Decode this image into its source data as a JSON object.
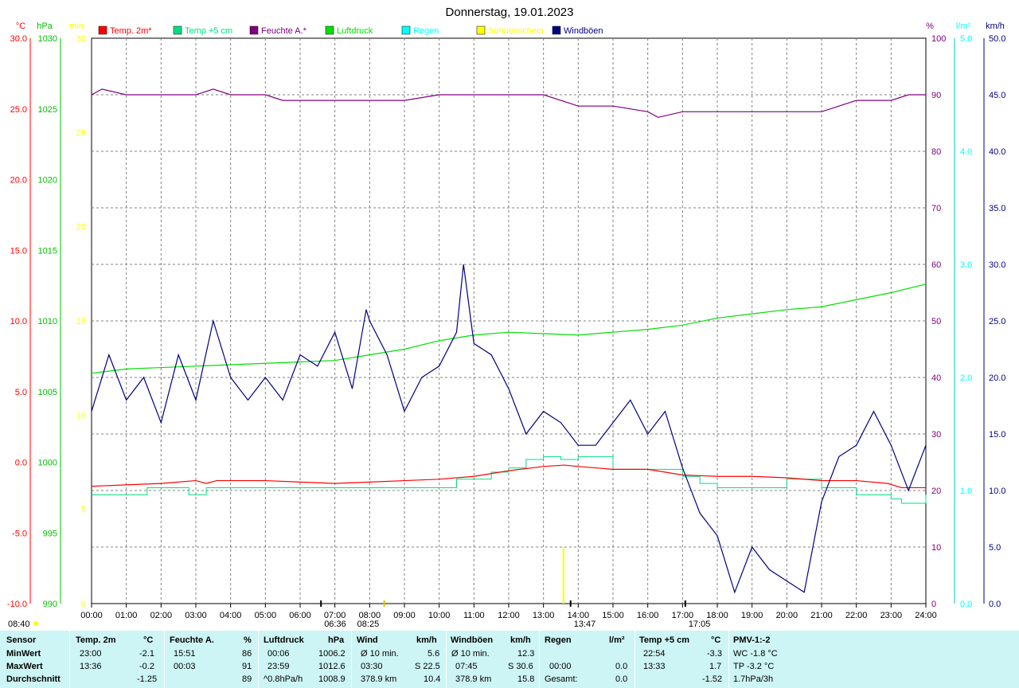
{
  "chart_data": {
    "type": "line",
    "title": "Donnerstag, 19.01.2023",
    "x_ticks": [
      "00:00",
      "01:00",
      "02:00",
      "03:00",
      "04:00",
      "05:00",
      "06:00",
      "07:00",
      "08:00",
      "09:00",
      "10:00",
      "11:00",
      "12:00",
      "13:00",
      "14:00",
      "15:00",
      "16:00",
      "17:00",
      "18:00",
      "19:00",
      "20:00",
      "21:00",
      "22:00",
      "23:00",
      "24:00"
    ],
    "axes": {
      "temp": {
        "unit": "°C",
        "color": "#ff0000",
        "range": [
          -10,
          30
        ],
        "ticks": [
          "30.0",
          "25.0",
          "20.0",
          "15.0",
          "10.0",
          "5.0",
          "0.0",
          "-5.0",
          "-10.0"
        ]
      },
      "press": {
        "unit": "hPa",
        "color": "#00c000",
        "range": [
          990,
          1030
        ],
        "ticks": [
          "1030",
          "1025",
          "1020",
          "1015",
          "1010",
          "1005",
          "1000",
          "995",
          "990"
        ]
      },
      "sun": {
        "unit": "min",
        "color": "#ffff00",
        "range": [
          0,
          30
        ],
        "ticks": [
          "30",
          "25",
          "20",
          "15",
          "10",
          "5",
          "0"
        ]
      },
      "hum": {
        "unit": "%",
        "color": "#800080",
        "range": [
          0,
          100
        ],
        "ticks": [
          "100",
          "90",
          "80",
          "70",
          "60",
          "50",
          "40",
          "30",
          "20",
          "10",
          "0"
        ]
      },
      "rain": {
        "unit": "l/m²",
        "color": "#00ffff",
        "range": [
          0,
          5
        ],
        "ticks": [
          "5.0",
          "4.0",
          "3.0",
          "2.0",
          "1.0",
          "0.0"
        ]
      },
      "wind": {
        "unit": "km/h",
        "color": "#000080",
        "range": [
          0,
          50
        ],
        "ticks": [
          "50.0",
          "45.0",
          "40.0",
          "35.0",
          "30.0",
          "25.0",
          "20.0",
          "15.0",
          "10.0",
          "5.0",
          "0.0"
        ]
      }
    },
    "legend": [
      {
        "name": "Temp. 2m*",
        "color": "#ff0000"
      },
      {
        "name": "Temp +5 cm",
        "color": "#00e080"
      },
      {
        "name": "Feuchte A.*",
        "color": "#800080"
      },
      {
        "name": "Luftdruck",
        "color": "#00e000"
      },
      {
        "name": "Regen",
        "color": "#00ffff"
      },
      {
        "name": "Sonnenschein",
        "color": "#ffff00"
      },
      {
        "name": "Windböen",
        "color": "#000080"
      }
    ],
    "series": {
      "temp2m": {
        "x": [
          0,
          1,
          2,
          3,
          3.3,
          3.6,
          4,
          5,
          6,
          7,
          8,
          9,
          10,
          11,
          12,
          13,
          13.6,
          14,
          15,
          16,
          17,
          18,
          19,
          20,
          21,
          22,
          22.9,
          23.3,
          24
        ],
        "y": [
          -1.7,
          -1.6,
          -1.5,
          -1.3,
          -1.5,
          -1.3,
          -1.3,
          -1.3,
          -1.4,
          -1.5,
          -1.4,
          -1.3,
          -1.2,
          -1.0,
          -0.6,
          -0.3,
          -0.2,
          -0.3,
          -0.5,
          -0.5,
          -0.9,
          -1.0,
          -1.0,
          -1.1,
          -1.3,
          -1.3,
          -1.5,
          -1.8,
          -1.8
        ]
      },
      "temp5cm": {
        "x": [
          0,
          1.5,
          1.6,
          2,
          2.8,
          3.3,
          4,
          5,
          6,
          7,
          8,
          9,
          10,
          10.5,
          11,
          11.5,
          12,
          12.5,
          13,
          13.5,
          14,
          15,
          16,
          17,
          17.5,
          18,
          19,
          20,
          21,
          21.5,
          22,
          23,
          23.3,
          24
        ],
        "y": [
          -2.3,
          -2.3,
          -1.8,
          -1.8,
          -2.3,
          -1.8,
          -1.8,
          -1.8,
          -1.8,
          -1.8,
          -1.8,
          -1.8,
          -1.8,
          -1.2,
          -1.2,
          -0.7,
          -0.4,
          0.2,
          0.4,
          0.2,
          0.4,
          -0.5,
          -0.5,
          -1.0,
          -1.5,
          -1.8,
          -1.8,
          -1.2,
          -1.8,
          -1.8,
          -2.3,
          -2.6,
          -2.9,
          -2.3
        ]
      },
      "humidity": {
        "x": [
          0,
          0.3,
          1,
          2,
          3,
          3.5,
          4,
          5,
          5.5,
          6,
          7,
          8,
          9,
          10,
          11,
          12,
          13,
          13.5,
          14,
          15,
          16,
          16.3,
          17,
          18,
          19,
          20,
          20.5,
          21,
          22,
          23,
          23.5,
          24
        ],
        "y": [
          90,
          91,
          90,
          90,
          90,
          91,
          90,
          90,
          89,
          89,
          89,
          89,
          89,
          90,
          90,
          90,
          90,
          89,
          88,
          88,
          87,
          86,
          87,
          87,
          87,
          87,
          87,
          87,
          89,
          89,
          90,
          90
        ]
      },
      "pressure": {
        "x": [
          0,
          1,
          2,
          3,
          4,
          5,
          6,
          7,
          8,
          9,
          10,
          11,
          12,
          13,
          14,
          15,
          16,
          17,
          18,
          19,
          20,
          21,
          22,
          23,
          24
        ],
        "y": [
          1006.3,
          1006.6,
          1006.7,
          1006.8,
          1006.9,
          1007.0,
          1007.1,
          1007.2,
          1007.6,
          1008.0,
          1008.6,
          1009.0,
          1009.2,
          1009.1,
          1009.0,
          1009.2,
          1009.4,
          1009.7,
          1010.2,
          1010.5,
          1010.8,
          1011.0,
          1011.5,
          1012.0,
          1012.6
        ]
      },
      "gusts": {
        "x": [
          0,
          0.5,
          1,
          1.5,
          2,
          2.5,
          3,
          3.5,
          4,
          4.5,
          5,
          5.5,
          6,
          6.5,
          7,
          7.5,
          7.9,
          8,
          8.5,
          9,
          9.5,
          10,
          10.5,
          10.7,
          11,
          11.5,
          12,
          12.5,
          13,
          13.5,
          14,
          14.5,
          15,
          15.5,
          16,
          16.5,
          17,
          17.5,
          18,
          18.5,
          19,
          19.5,
          20,
          20.5,
          21,
          21.5,
          22,
          22.5,
          23,
          23.5,
          24
        ],
        "y": [
          17,
          22,
          18,
          20,
          16,
          22,
          18,
          25,
          20,
          18,
          20,
          18,
          22,
          21,
          24,
          19,
          26,
          25,
          22,
          17,
          20,
          21,
          24,
          30,
          23,
          22,
          19,
          15,
          17,
          16,
          14,
          14,
          16,
          18,
          15,
          17,
          12,
          8,
          6,
          1,
          5,
          3,
          2,
          1,
          9,
          13,
          14,
          17,
          14,
          10,
          14
        ]
      }
    },
    "markers": [
      {
        "label": "06:36",
        "x": 6.6
      },
      {
        "label": "08:25",
        "x": 8.42
      },
      {
        "label": "13:47",
        "x": 13.78
      },
      {
        "label": "17:05",
        "x": 17.08
      },
      {
        "label": "08:40",
        "x": 0
      }
    ],
    "sunshine": [
      {
        "x": 13.55,
        "value": 3
      }
    ]
  },
  "stats": {
    "headers": {
      "sensor": "Sensor",
      "temp": "Temp. 2m",
      "temp_unit": "°C",
      "hum": "Feuchte A.",
      "hum_unit": "%",
      "press": "Luftdruck",
      "press_unit": "hPa",
      "wind": "Wind",
      "wind_unit": "km/h",
      "gust": "Windböen",
      "gust_unit": "km/h",
      "rain": "Regen",
      "rain_unit": "l/m²",
      "t5": "Temp +5 cm",
      "t5_unit": "°C",
      "pmv": "PMV-1:-2"
    },
    "rows": [
      {
        "label": "MinWert",
        "temp_time": "23:00",
        "temp_val": "-2.1",
        "hum_time": "15:51",
        "hum_val": "86",
        "press_time": "00:06",
        "press_val": "1006.2",
        "wind_a": "Ø 10 min.",
        "wind_val": "5.6",
        "gust_a": "Ø 10 min.",
        "gust_val": "12.3",
        "rain_a": "",
        "rain_val": "",
        "t5_time": "22:54",
        "t5_val": "-3.3",
        "pmv": "WC -1.8 °C"
      },
      {
        "label": "MaxWert",
        "temp_time": "13:36",
        "temp_val": "-0.2",
        "hum_time": "00:03",
        "hum_val": "91",
        "press_time": "23:59",
        "press_val": "1012.6",
        "wind_a": "03:30",
        "wind_val": "S 22.5",
        "gust_a": "07:45",
        "gust_val": "S 30.6",
        "rain_a": "00:00",
        "rain_val": "0.0",
        "t5_time": "13:33",
        "t5_val": "1.7",
        "pmv": "TP -3.2 °C"
      },
      {
        "label": "Durchschnitt",
        "temp_time": "",
        "temp_val": "-1.25",
        "hum_time": "",
        "hum_val": "89",
        "press_time": "^0.8hPa/h",
        "press_val": "1008.9",
        "wind_a": "378.9 km",
        "wind_val": "10.4",
        "gust_a": "378.9 km",
        "gust_val": "15.8",
        "rain_a": "Gesamt:",
        "rain_val": "0.0",
        "t5_time": "",
        "t5_val": "-1.52",
        "pmv": "1.7hPa/3h"
      }
    ]
  }
}
